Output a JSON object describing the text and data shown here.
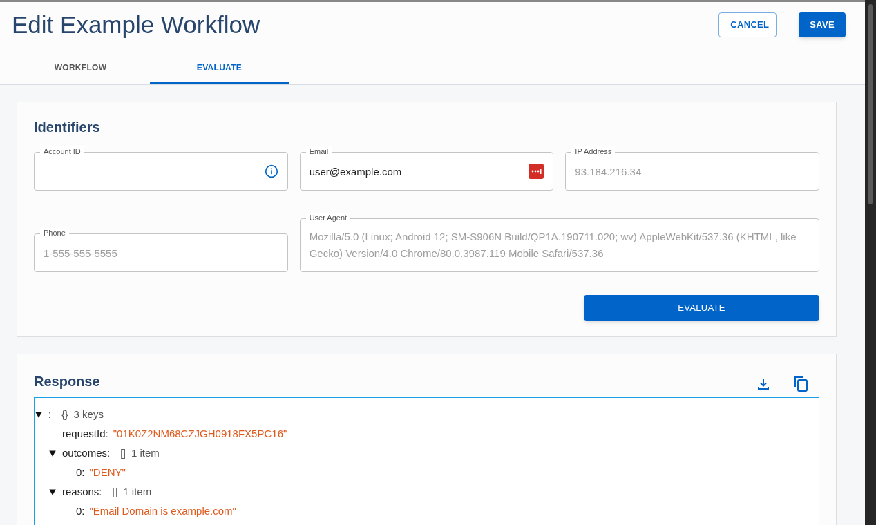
{
  "header": {
    "title": "Edit Example Workflow",
    "buttons": [
      {
        "kind": "outline",
        "label": "CANCEL"
      },
      {
        "kind": "primary",
        "label": "SAVE"
      }
    ]
  },
  "tabs": [
    {
      "label": "WORKFLOW",
      "selected": false
    },
    {
      "label": "EVALUATE",
      "selected": true
    }
  ],
  "identifiers": {
    "title": "Identifiers",
    "fields": [
      {
        "label": "Account ID",
        "kind": "info"
      },
      {
        "label": "Email",
        "value": "user@example.com",
        "kind": "password-manager"
      },
      {
        "label": "IP Address",
        "placeholder": "93.184.216.34",
        "kind": "plain"
      },
      {
        "label": "Phone",
        "placeholder": "1-555-555-5555",
        "kind": "plain"
      },
      {
        "label": "User Agent",
        "placeholder": "Mozilla/5.0 (Linux; Android 12; SM-S906N Build/QP1A.190711.020; wv) AppleWebKit/537.36 (KHTML, like Gecko) Version/4.0 Chrome/80.0.3987.119 Mobile Safari/537.36",
        "kind": "multiline"
      }
    ],
    "button": "EVALUATE"
  },
  "response": {
    "title": "Response",
    "tree": [
      {
        "kind": "object",
        "key": ":",
        "brackets": "{}",
        "count": "3 keys",
        "expanded": true,
        "children": [
          {
            "kind": "value",
            "key": "requestId:",
            "value": "\"01K0Z2NM68CZJGH0918FX5PC16\""
          },
          {
            "kind": "array",
            "key": "outcomes:",
            "brackets": "[]",
            "count": "1 item",
            "expanded": true,
            "children": [
              {
                "kind": "value",
                "key": "0:",
                "value": "\"DENY\""
              }
            ]
          },
          {
            "kind": "array",
            "key": "reasons:",
            "brackets": "[]",
            "count": "1 item",
            "expanded": true,
            "children": [
              {
                "kind": "value",
                "key": "0:",
                "value": "\"Email Domain is example.com\""
              }
            ]
          }
        ]
      }
    ]
  }
}
